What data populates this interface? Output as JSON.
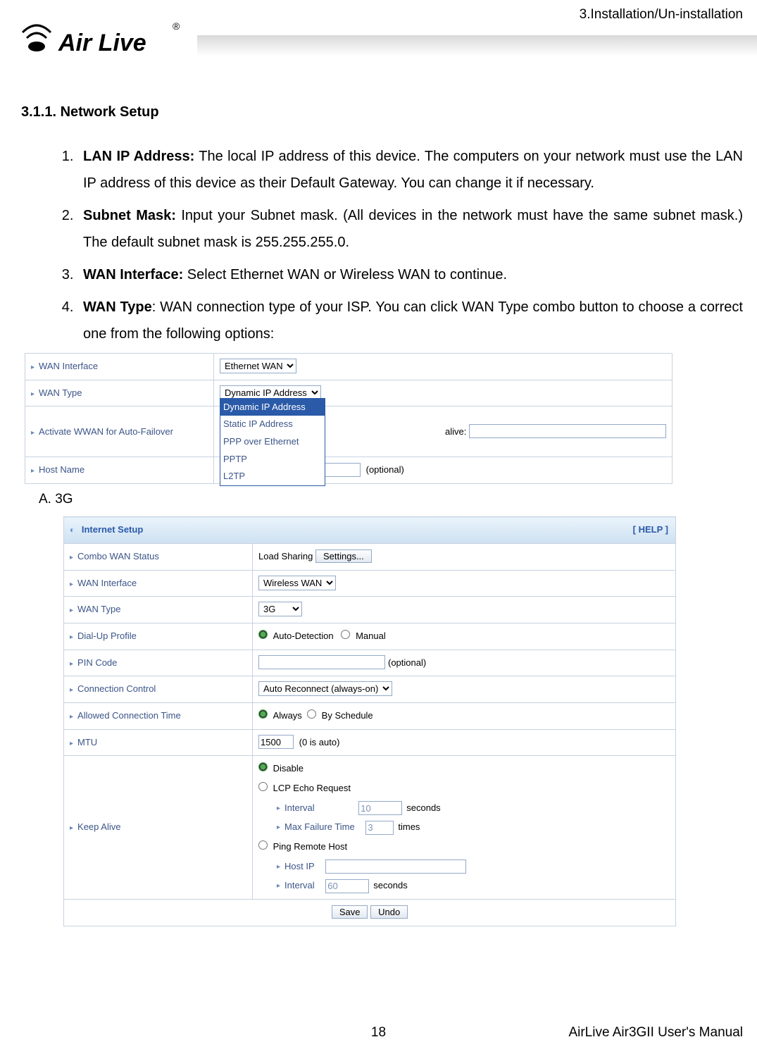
{
  "header": {
    "chapter": "3.Installation/Un-installation",
    "logo_text": "Air Live",
    "logo_reg": "®"
  },
  "section": {
    "number": "3.1.1. Network Setup",
    "items": [
      {
        "title": "LAN IP Address:",
        "text": " The local IP address of this device. The computers on your network must use the LAN IP address of this device as their Default Gateway. You can change it if necessary."
      },
      {
        "title": "Subnet Mask:",
        "text": " Input your Subnet mask. (All devices in the network must have the same subnet mask.) The default subnet mask is 255.255.255.0."
      },
      {
        "title": "WAN Interface:",
        "text": " Select Ethernet WAN or Wireless WAN to continue."
      },
      {
        "title": "WAN Type",
        "text": ": WAN connection type of your ISP. You can click WAN Type combo button to choose a correct one from the following options:"
      }
    ]
  },
  "table1": {
    "rows": {
      "wan_interface": {
        "label": "WAN Interface",
        "value": "Ethernet WAN"
      },
      "wan_type": {
        "label": "WAN Type",
        "value": "Dynamic IP Address",
        "options": [
          "Dynamic IP Address",
          "Static IP Address",
          "PPP over Ethernet",
          "PPTP",
          "L2TP"
        ]
      },
      "activate": {
        "label": "Activate WWAN for Auto-Failover",
        "right_text": "alive:"
      },
      "host_name": {
        "label": "Host Name",
        "note": "(optional)"
      }
    }
  },
  "subsection_a": "A. 3G",
  "table2": {
    "title": "Internet Setup",
    "help": "[ HELP ]",
    "rows": {
      "combo": {
        "label": "Combo WAN Status",
        "text": "Load Sharing",
        "btn": "Settings..."
      },
      "wan_interface": {
        "label": "WAN Interface",
        "value": "Wireless WAN"
      },
      "wan_type": {
        "label": "WAN Type",
        "value": "3G"
      },
      "dial": {
        "label": "Dial-Up Profile",
        "opt1": "Auto-Detection",
        "opt2": "Manual"
      },
      "pin": {
        "label": "PIN Code",
        "note": "(optional)"
      },
      "conn_ctrl": {
        "label": "Connection Control",
        "value": "Auto Reconnect (always-on)"
      },
      "allowed": {
        "label": "Allowed Connection Time",
        "opt1": "Always",
        "opt2": "By Schedule"
      },
      "mtu": {
        "label": "MTU",
        "value": "1500",
        "note": "(0 is auto)"
      },
      "keep_alive": {
        "label": "Keep Alive",
        "opt_disable": "Disable",
        "opt_lcp": "LCP Echo Request",
        "interval_label": "Interval",
        "interval_val": "10",
        "seconds": "seconds",
        "maxfail_label": "Max Failure Time",
        "maxfail_val": "3",
        "times": "times",
        "opt_ping": "Ping Remote Host",
        "hostip_label": "Host IP",
        "interval2_val": "60"
      },
      "save": {
        "save": "Save",
        "undo": "Undo"
      }
    }
  },
  "footer": {
    "page": "18",
    "manual": "AirLive Air3GII User's Manual"
  }
}
